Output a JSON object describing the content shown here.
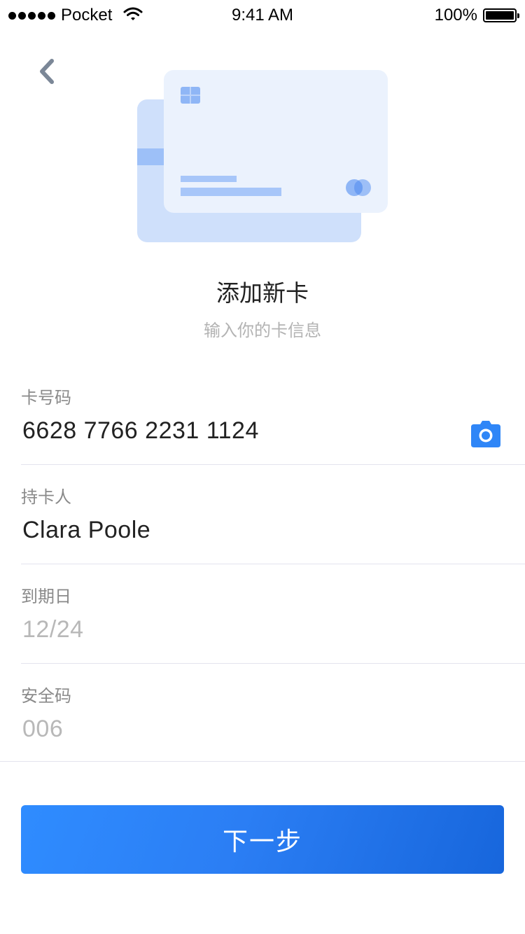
{
  "status_bar": {
    "carrier": "Pocket",
    "time": "9:41 AM",
    "battery": "100%"
  },
  "header": {
    "back_icon": "chevron-left-icon",
    "title": "添加新卡",
    "subtitle": "输入你的卡信息"
  },
  "form": {
    "card_number": {
      "label": "卡号码",
      "value": "6628 7766 2231 1124",
      "icon": "camera-icon"
    },
    "holder": {
      "label": "持卡人",
      "value": "Clara Poole"
    },
    "expiry": {
      "label": "到期日",
      "placeholder": "12/24"
    },
    "cvv": {
      "label": "安全码",
      "placeholder": "006"
    }
  },
  "actions": {
    "next_label": "下一步"
  },
  "colors": {
    "accent": "#2f86f7",
    "card_front": "#ebf2fd",
    "card_back": "#cfe0fb",
    "label": "#8a8a8a",
    "placeholder": "#b8b8b8",
    "divider": "#e3e3ee"
  }
}
